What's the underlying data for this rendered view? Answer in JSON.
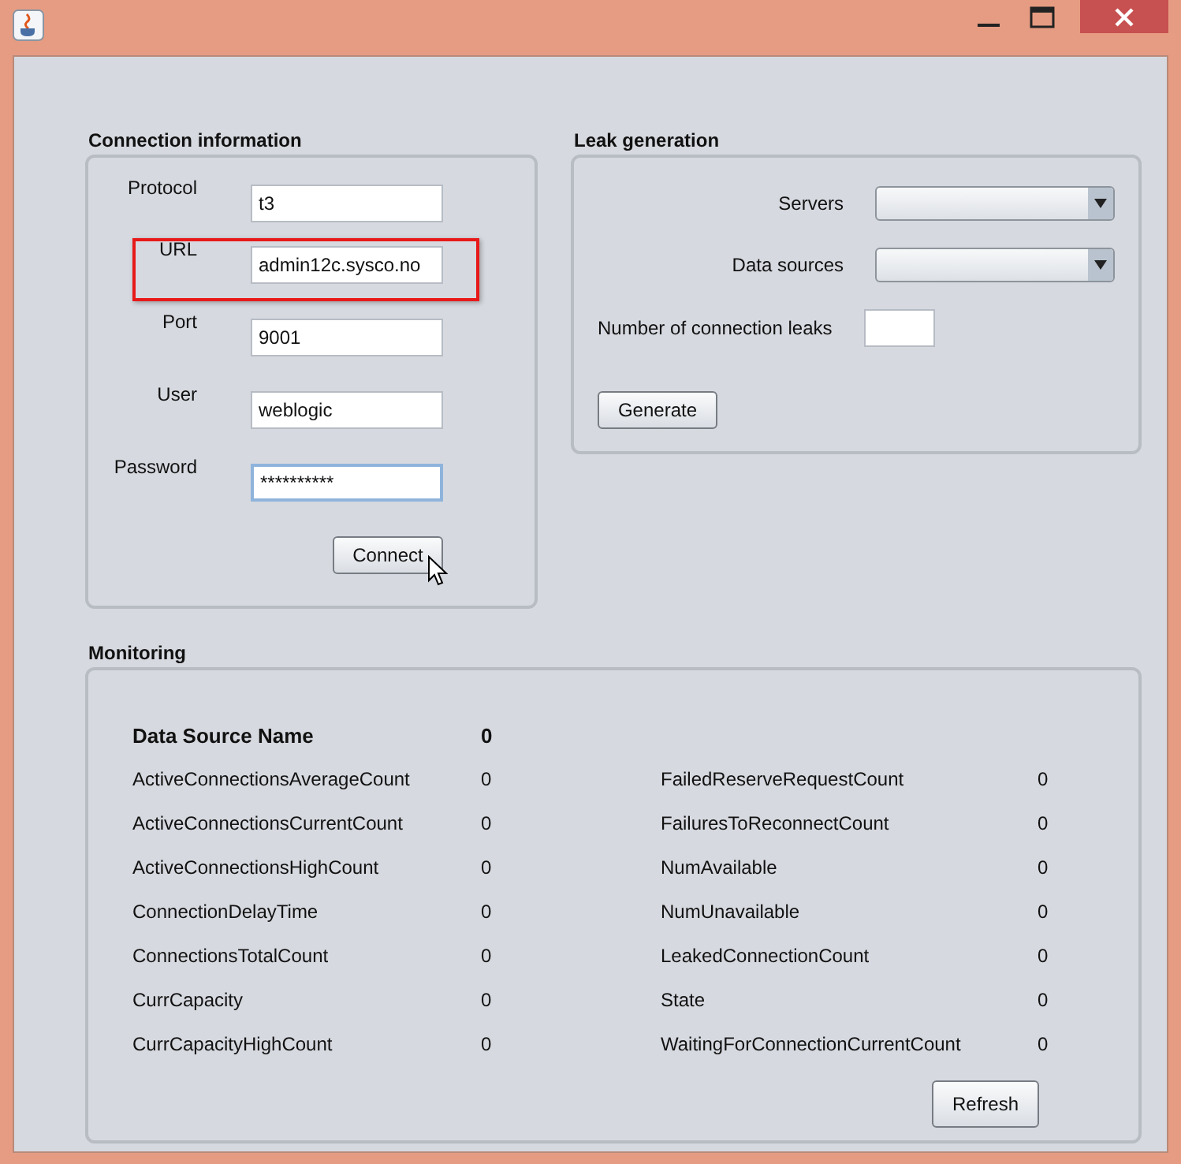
{
  "connection": {
    "title": "Connection information",
    "fields": [
      {
        "label": "Protocol",
        "value": "t3",
        "highlighted": false,
        "focused": false
      },
      {
        "label": "URL",
        "value": "admin12c.sysco.no",
        "highlighted": true,
        "focused": false
      },
      {
        "label": "Port",
        "value": "9001",
        "highlighted": false,
        "focused": false
      },
      {
        "label": "User",
        "value": "weblogic",
        "highlighted": false,
        "focused": false
      },
      {
        "label": "Password",
        "value": "**********",
        "highlighted": false,
        "focused": true
      }
    ],
    "button": "Connect"
  },
  "leak": {
    "title": "Leak generation",
    "servers_label": "Servers",
    "datasources_label": "Data sources",
    "count_label": "Number of connection leaks",
    "button": "Generate"
  },
  "monitoring": {
    "title": "Monitoring",
    "header_name": "Data Source Name",
    "header_value": "0",
    "left": [
      {
        "name": "ActiveConnectionsAverageCount",
        "value": "0"
      },
      {
        "name": "ActiveConnectionsCurrentCount",
        "value": "0"
      },
      {
        "name": "ActiveConnectionsHighCount",
        "value": "0"
      },
      {
        "name": "ConnectionDelayTime",
        "value": "0"
      },
      {
        "name": "ConnectionsTotalCount",
        "value": "0"
      },
      {
        "name": "CurrCapacity",
        "value": "0"
      },
      {
        "name": "CurrCapacityHighCount",
        "value": "0"
      }
    ],
    "right": [
      {
        "name": "FailedReserveRequestCount",
        "value": "0"
      },
      {
        "name": "FailuresToReconnectCount",
        "value": "0"
      },
      {
        "name": "NumAvailable",
        "value": "0"
      },
      {
        "name": "NumUnavailable",
        "value": "0"
      },
      {
        "name": "LeakedConnectionCount",
        "value": "0"
      },
      {
        "name": "State",
        "value": "0"
      },
      {
        "name": "WaitingForConnectionCurrentCount",
        "value": "0"
      }
    ],
    "button": "Refresh"
  }
}
